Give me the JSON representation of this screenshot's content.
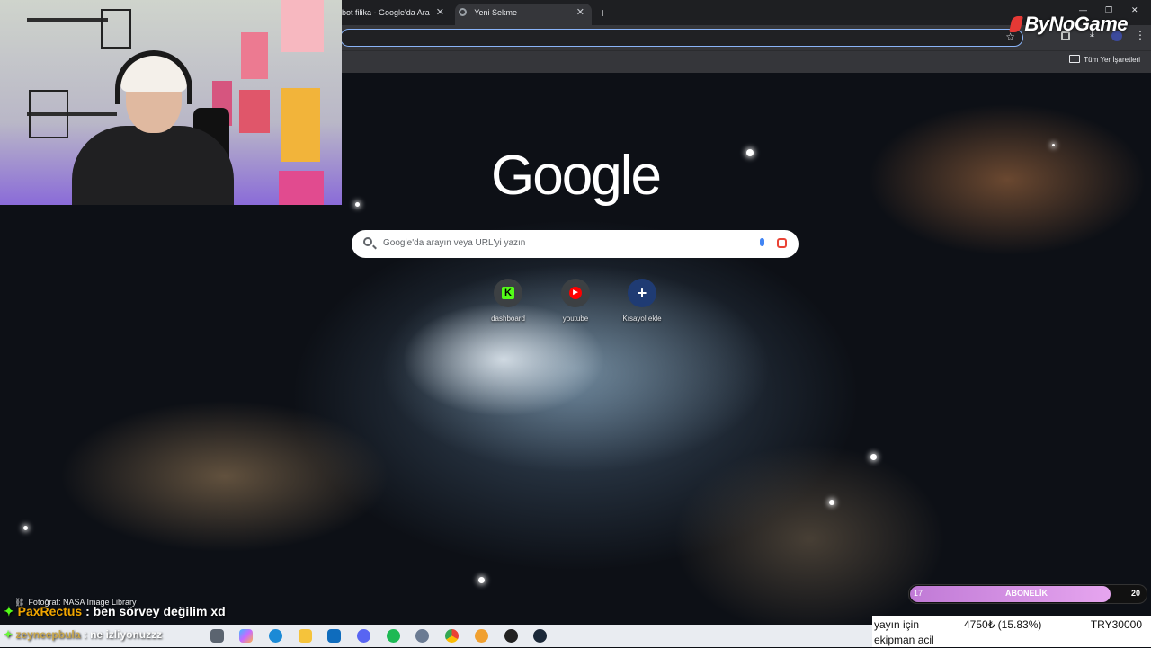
{
  "browser": {
    "tabs": [
      {
        "label": "bot filika - Google'da Ara",
        "active": false
      },
      {
        "label": "Yeni Sekme",
        "active": true
      }
    ],
    "all_bookmarks_label": "Tüm Yer İşaretleri"
  },
  "brand_logo": "ByNoGame",
  "newtab": {
    "logo_text": "Google",
    "search_placeholder": "Google'da arayın veya URL'yi yazın",
    "shortcuts": [
      {
        "label": "dashboard",
        "icon": "kick-icon",
        "glyph": "K",
        "color": "#53fc18"
      },
      {
        "label": "youtube",
        "icon": "youtube-icon",
        "glyph": "▶",
        "color": "#ff0000"
      },
      {
        "label": "Kısayol ekle",
        "icon": "plus-icon",
        "glyph": "+",
        "color": "#8ab4f8"
      }
    ],
    "photo_credit": "Fotoğraf: NASA Image Library"
  },
  "stream_overlay": {
    "chat": [
      {
        "user": "PaxRectus",
        "message": " : ben sörvey değilim xd"
      },
      {
        "user": "zeyneepbula",
        "message": " : ne izliyonuzzz"
      }
    ],
    "subscriber_goal": {
      "label": "ABONELİK",
      "current": "17",
      "target": "20",
      "progress": 0.85
    },
    "donation": {
      "label_line1": "yayın için",
      "label_line2": "ekipman acil",
      "amount": "4750₺ (15.83%)",
      "goal": "TRY30000"
    }
  },
  "taskbar": {
    "icons": [
      "widgets-icon",
      "copilot-icon",
      "edge-icon",
      "file-explorer-icon",
      "outlook-icon",
      "discord-icon",
      "spotify-icon",
      "settings-icon",
      "chrome-icon",
      "audio-icon",
      "obs-icon",
      "steam-icon"
    ]
  }
}
